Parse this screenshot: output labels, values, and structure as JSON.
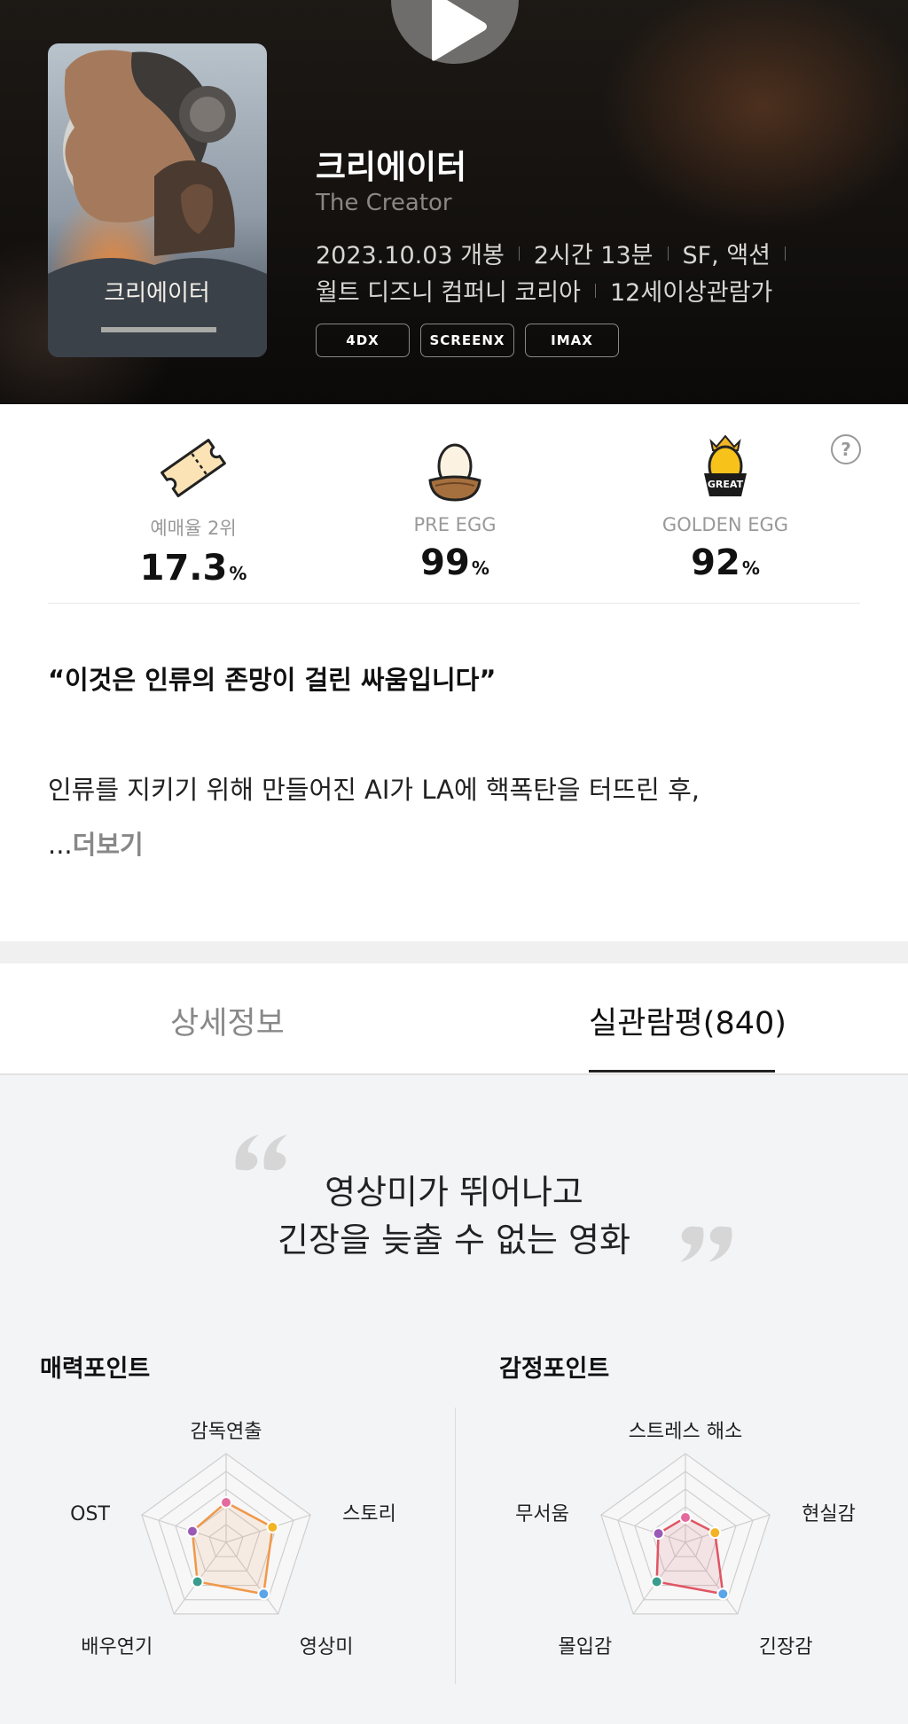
{
  "movie": {
    "title": "크리에이터",
    "original_title": "The Creator",
    "release": "2023.10.03 개봉",
    "runtime": "2시간 13분",
    "genre": "SF, 액션",
    "distributor": "월트 디즈니 컴퍼니 코리아",
    "rating": "12세이상관람가",
    "formats": [
      "4DX",
      "SCREENX",
      "IMAX"
    ],
    "poster_title": "크리에이터"
  },
  "stats": [
    {
      "label": "예매율 2위",
      "value": "17.3",
      "unit": "%",
      "icon": "ticket-icon"
    },
    {
      "label": "PRE EGG",
      "value": "99",
      "unit": "%",
      "icon": "egg-nest-icon"
    },
    {
      "label": "GOLDEN EGG",
      "value": "92",
      "unit": "%",
      "icon": "golden-egg-great-icon",
      "badge": "GREAT"
    }
  ],
  "help_label": "?",
  "tagline": "“이것은 인류의 존망이 걸린 싸움입니다”",
  "synopsis": "인류를 지키기 위해 만들어진 AI가 LA에 핵폭탄을 터뜨린 후,",
  "synopsis_prefix": "...",
  "more_label": "더보기",
  "tabs": [
    {
      "label": "상세정보",
      "active": false
    },
    {
      "label": "실관람평(840)",
      "active": true
    }
  ],
  "review": {
    "headline_line1": "영상미가 뛰어나고",
    "headline_line2": "긴장을 늦출 수 없는 영화"
  },
  "charm_points": {
    "title": "매력포인트",
    "axes": [
      "감독연출",
      "스토리",
      "영상미",
      "배우연기",
      "OST"
    ],
    "values": [
      0.45,
      0.55,
      0.72,
      0.55,
      0.4
    ],
    "colors": [
      "#e46a9e",
      "#f2b424",
      "#5aa5e8",
      "#3a9c8c",
      "#9b59b6"
    ],
    "line_color": "#f0984a"
  },
  "emotion_points": {
    "title": "감정포인트",
    "axes": [
      "스트레스 해소",
      "현실감",
      "긴장감",
      "몰입감",
      "무서움"
    ],
    "values": [
      0.28,
      0.35,
      0.72,
      0.55,
      0.32
    ],
    "colors": [
      "#e46a9e",
      "#f2b424",
      "#5aa5e8",
      "#3a9c8c",
      "#9b59b6"
    ],
    "line_color": "#e05563"
  }
}
